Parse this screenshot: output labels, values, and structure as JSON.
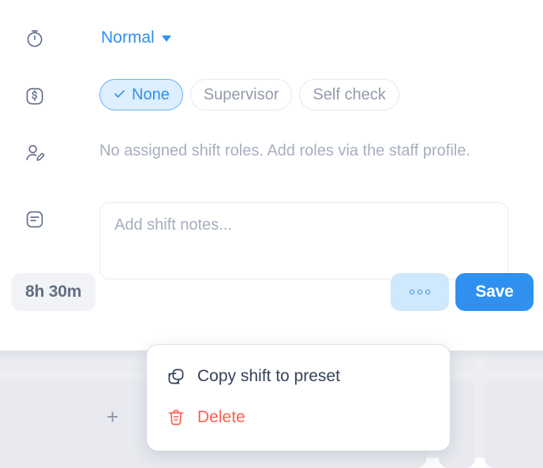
{
  "panel": {
    "shift_type_row": {
      "icon": "stopwatch-icon",
      "value": "Normal"
    },
    "break_row": {
      "icon": "dollar-square-icon",
      "options": [
        {
          "label": "None",
          "selected": true,
          "icon": "check-icon"
        },
        {
          "label": "Supervisor",
          "selected": false
        },
        {
          "label": "Self check",
          "selected": false
        }
      ]
    },
    "roles_row": {
      "icon": "user-edit-icon",
      "text": "No assigned shift roles. Add roles via the staff profile."
    },
    "notes_row": {
      "icon": "notes-icon",
      "placeholder": "Add shift notes...",
      "value": ""
    }
  },
  "footer": {
    "duration": "8h 30m",
    "more_label": "more-options",
    "save_label": "Save"
  },
  "menu": {
    "items": [
      {
        "label": "Copy shift to preset",
        "icon": "copy-icon",
        "danger": false
      },
      {
        "label": "Delete",
        "icon": "trash-icon",
        "danger": true
      }
    ]
  },
  "background": {
    "add_shift_label": "+"
  },
  "colors": {
    "accent": "#2f90f0",
    "accent_soft": "#ddeefe",
    "accent_button_soft": "#cfe8fb",
    "danger": "#fa5f51",
    "muted_text": "#a6aebe",
    "dark_text": "#36405a",
    "icon_stroke": "#5c6a87",
    "bg_strip": "#eceef2",
    "bg_cell": "#e8eaef"
  }
}
